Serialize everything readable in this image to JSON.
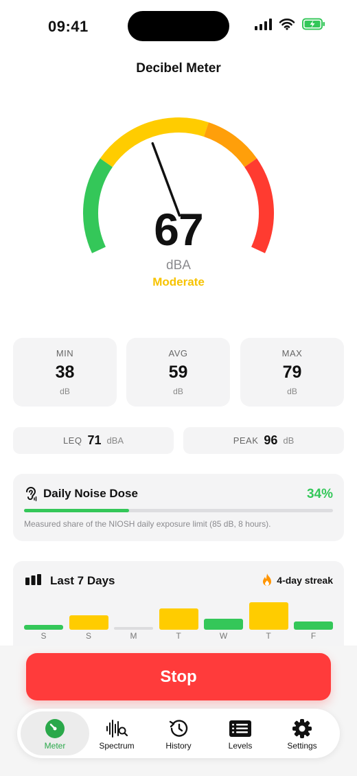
{
  "status_bar": {
    "time": "09:41"
  },
  "title": "Decibel Meter",
  "meter": {
    "reading": "67",
    "unit": "dBA",
    "level": "Moderate",
    "scale_min_db": 30,
    "scale_max_db": 120,
    "needle_value_db": 67
  },
  "stats": [
    {
      "label": "MIN",
      "value": "38",
      "unit": "dB"
    },
    {
      "label": "AVG",
      "value": "59",
      "unit": "dB"
    },
    {
      "label": "MAX",
      "value": "79",
      "unit": "dB"
    }
  ],
  "leq": {
    "label": "LEQ",
    "value": "71",
    "unit": "dBA"
  },
  "peak": {
    "label": "PEAK",
    "value": "96",
    "unit": "dB"
  },
  "dose": {
    "title": "Daily Noise Dose",
    "percent": "34%",
    "fraction": 0.34,
    "note": "Measured share of the NIOSH daily exposure limit (85 dB, 8 hours)."
  },
  "week": {
    "title": "Last 7 Days",
    "streak": "4-day streak",
    "days": [
      "S",
      "S",
      "M",
      "T",
      "W",
      "T",
      "F"
    ],
    "relative_levels": [
      0.15,
      0.42,
      0.08,
      0.62,
      0.32,
      0.8,
      0.25
    ],
    "bar_colors": [
      "#34c759",
      "#ffcc00",
      "#dcdcde",
      "#ffcc00",
      "#34c759",
      "#ffcc00",
      "#34c759"
    ]
  },
  "stop_label": "Stop",
  "tabs": [
    {
      "label": "Meter",
      "icon": "meter-icon",
      "active": true
    },
    {
      "label": "Spectrum",
      "icon": "spectrum-icon",
      "active": false
    },
    {
      "label": "History",
      "icon": "history-icon",
      "active": false
    },
    {
      "label": "Levels",
      "icon": "levels-icon",
      "active": false
    },
    {
      "label": "Settings",
      "icon": "gear-icon",
      "active": false
    }
  ],
  "colors": {
    "quiet": "#34c759",
    "moderate": "#ffcc00",
    "loud": "#ff9f0a",
    "danger": "#ff3b30",
    "stop_button": "#ff3b3b",
    "active_tab": "#2aa84a"
  }
}
